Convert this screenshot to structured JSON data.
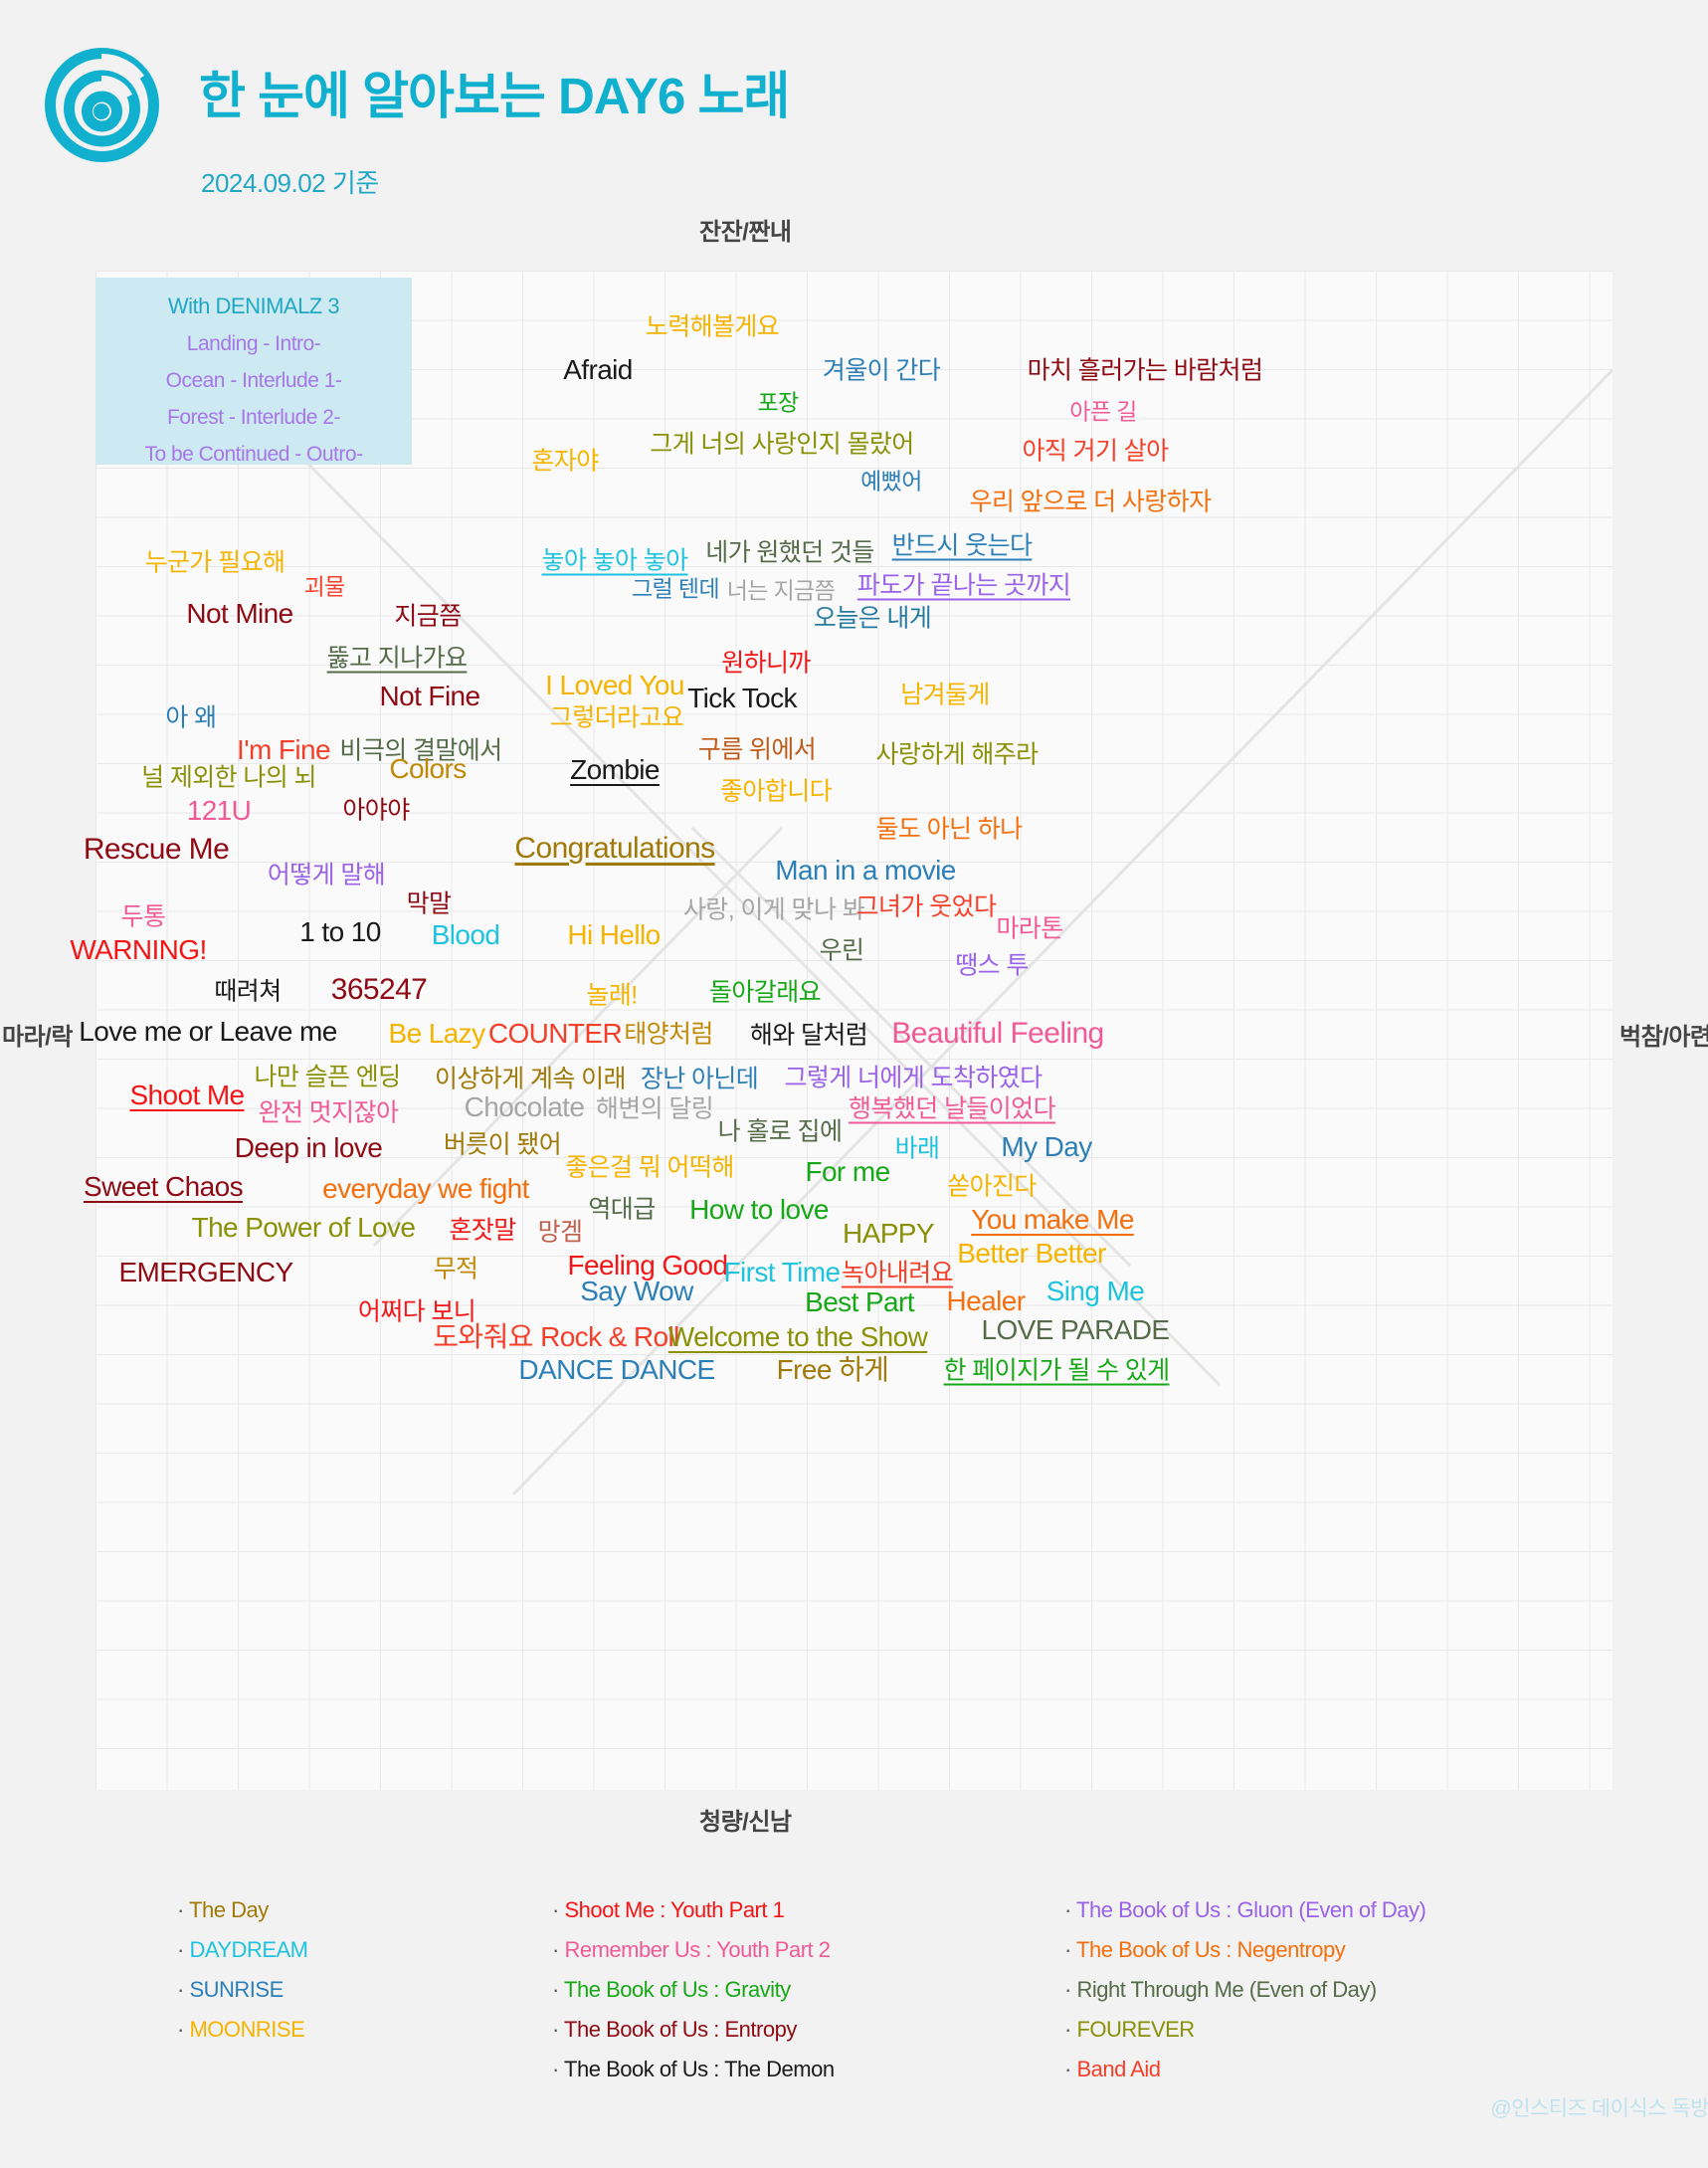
{
  "header": {
    "title": "한 눈에 알아보는 DAY6 노래",
    "subtitle": "2024.09.02 기준",
    "logo_icon": "day6-spiral-logo",
    "brand_color": "#12b0cf"
  },
  "axes": {
    "top": "잔잔/짠내",
    "bottom": "청량/신남",
    "left": "마라/락",
    "right": "벅참/아련"
  },
  "denimalz": {
    "title": "With DENIMALZ 3",
    "lines": [
      "Landing - Intro-",
      "Ocean - Interlude 1-",
      "Forest - Interlude 2-",
      "To be Continued - Outro-"
    ]
  },
  "credit": "@인스티즈 데이식스 독방",
  "legend": {
    "columns": [
      [
        {
          "label": "The Day",
          "color": "#a07a08"
        },
        {
          "label": "DAYDREAM",
          "color": "#1fc3dd"
        },
        {
          "label": "SUNRISE",
          "color": "#2d7fb8"
        },
        {
          "label": "MOONRISE",
          "color": "#f5b400"
        }
      ],
      [
        {
          "label": "Shoot Me : Youth Part 1",
          "color": "#f41616"
        },
        {
          "label": "Remember Us : Youth Part 2",
          "color": "#f05a96"
        },
        {
          "label": "The Book of Us : Gravity",
          "color": "#17a817"
        },
        {
          "label": "The Book of Us : Entropy",
          "color": "#8e0b15"
        },
        {
          "label": "The Book of Us : The Demon",
          "color": "#1a1a1a"
        }
      ],
      [
        {
          "label": "The Book of Us : Gluon (Even of Day)",
          "color": "#9a62e8"
        },
        {
          "label": "The Book of Us : Negentropy",
          "color": "#f4700f"
        },
        {
          "label": "Right Through Me (Even of Day)",
          "color": "#566b4a"
        },
        {
          "label": "FOUREVER",
          "color": "#8a9107"
        },
        {
          "label": "Band Aid",
          "color": "#f4402a"
        }
      ]
    ]
  },
  "chart_data": {
    "type": "scatter",
    "title": "한 눈에 알아보는 DAY6 노래",
    "subtitle": "2024.09.02 기준",
    "xlabel": "마라/락 ↔ 벅참/아련",
    "ylabel": "잔잔/짠내 ↔ 청량/신남",
    "xlim": [
      0,
      1525
    ],
    "ylim": [
      0,
      1527
    ],
    "grid": true,
    "legend_position": "bottom",
    "points": [
      {
        "t": "노력해볼게요",
        "x": 620,
        "y": 57,
        "c": "#f5b400",
        "s": 25
      },
      {
        "t": "Afraid",
        "x": 505,
        "y": 100,
        "c": "#1a1a1a",
        "s": 28
      },
      {
        "t": "겨울이 간다",
        "x": 790,
        "y": 101,
        "c": "#2d7fb8",
        "s": 25
      },
      {
        "t": "마치 흘러가는 바람처럼",
        "x": 1055,
        "y": 101,
        "c": "#8e0b15",
        "s": 25
      },
      {
        "t": "포장",
        "x": 686,
        "y": 133,
        "c": "#17a817",
        "s": 23
      },
      {
        "t": "아픈 길",
        "x": 1013,
        "y": 142,
        "c": "#f05a96",
        "s": 23
      },
      {
        "t": "그게 너의 사랑인지 몰랐어",
        "x": 690,
        "y": 175,
        "c": "#8a9107",
        "s": 25
      },
      {
        "t": "아직 거기 살아",
        "x": 1005,
        "y": 182,
        "c": "#f4402a",
        "s": 25
      },
      {
        "t": "혼자야",
        "x": 472,
        "y": 192,
        "c": "#f5b400",
        "s": 25
      },
      {
        "t": "예뻤어",
        "x": 800,
        "y": 212,
        "c": "#2d7fb8",
        "s": 23
      },
      {
        "t": "우리 앞으로 더 사랑하자",
        "x": 1000,
        "y": 233,
        "c": "#f4700f",
        "s": 25
      },
      {
        "t": "반드시 웃는다",
        "x": 871,
        "y": 277,
        "c": "#2d7fb8",
        "s": 25,
        "u": true
      },
      {
        "t": "누군가 필요해",
        "x": 120,
        "y": 294,
        "c": "#f5b400",
        "s": 25
      },
      {
        "t": "놓아 놓아 놓아",
        "x": 522,
        "y": 292,
        "c": "#1fc3dd",
        "s": 25,
        "u": true
      },
      {
        "t": "네가 원했던 것들",
        "x": 698,
        "y": 284,
        "c": "#566b4a",
        "s": 25
      },
      {
        "t": "파도가 끝나는 곳까지",
        "x": 873,
        "y": 317,
        "c": "#9a62e8",
        "s": 25,
        "u": true
      },
      {
        "t": "괴물",
        "x": 230,
        "y": 318,
        "c": "#f4402a",
        "s": 23
      },
      {
        "t": "그럴 텐데",
        "x": 583,
        "y": 320,
        "c": "#2d7fb8",
        "s": 23
      },
      {
        "t": "너는 지금쯤",
        "x": 689,
        "y": 322,
        "c": "#a6a6a6",
        "s": 23
      },
      {
        "t": "Not Mine",
        "x": 145,
        "y": 345,
        "c": "#8e0b15",
        "s": 28
      },
      {
        "t": "지금쯤",
        "x": 334,
        "y": 348,
        "c": "#8e0b15",
        "s": 25
      },
      {
        "t": "오늘은 내게",
        "x": 781,
        "y": 350,
        "c": "#247b9e",
        "s": 25
      },
      {
        "t": "뚫고 지나가요",
        "x": 303,
        "y": 390,
        "c": "#566b4a",
        "s": 25,
        "u": true
      },
      {
        "t": "원하니까",
        "x": 674,
        "y": 395,
        "c": "#f41616",
        "s": 25
      },
      {
        "t": "Not Fine",
        "x": 336,
        "y": 428,
        "c": "#8e0b15",
        "s": 28
      },
      {
        "t": "I Loved You",
        "x": 522,
        "y": 417,
        "c": "#f5b400",
        "s": 28
      },
      {
        "t": "Tick Tock",
        "x": 650,
        "y": 430,
        "c": "#1a1a1a",
        "s": 28
      },
      {
        "t": "남겨둘게",
        "x": 854,
        "y": 427,
        "c": "#f5b400",
        "s": 25
      },
      {
        "t": "아 왜",
        "x": 96,
        "y": 450,
        "c": "#2d7fb8",
        "s": 25
      },
      {
        "t": "그렇더라고요",
        "x": 524,
        "y": 450,
        "c": "#f5b400",
        "s": 25
      },
      {
        "t": "I'm Fine",
        "x": 189,
        "y": 482,
        "c": "#f4402a",
        "s": 28
      },
      {
        "t": "비극의 결말에서",
        "x": 327,
        "y": 483,
        "c": "#566b4a",
        "s": 25
      },
      {
        "t": "구름 위에서",
        "x": 665,
        "y": 482,
        "c": "#c05b1a",
        "s": 25
      },
      {
        "t": "사랑하게 해주라",
        "x": 866,
        "y": 487,
        "c": "#8a9107",
        "s": 25
      },
      {
        "t": "널 제외한 나의 뇌",
        "x": 134,
        "y": 510,
        "c": "#8a9107",
        "s": 25
      },
      {
        "t": "Colors",
        "x": 334,
        "y": 501,
        "c": "#c08a08",
        "s": 28
      },
      {
        "t": "Zombie",
        "x": 522,
        "y": 502,
        "c": "#1a1a1a",
        "s": 28,
        "u": true
      },
      {
        "t": "좋아합니다",
        "x": 684,
        "y": 524,
        "c": "#f5b400",
        "s": 25
      },
      {
        "t": "121U",
        "x": 124,
        "y": 543,
        "c": "#f05a96",
        "s": 28
      },
      {
        "t": "아야야",
        "x": 282,
        "y": 543,
        "c": "#8e0b15",
        "s": 25
      },
      {
        "t": "둘도 아닌 하나",
        "x": 858,
        "y": 562,
        "c": "#f4700f",
        "s": 25
      },
      {
        "t": "Rescue Me",
        "x": 61,
        "y": 582,
        "c": "#8e0b15",
        "s": 30
      },
      {
        "t": "Congratulations",
        "x": 522,
        "y": 581,
        "c": "#a07a08",
        "s": 30,
        "u": true
      },
      {
        "t": "Man in a movie",
        "x": 774,
        "y": 603,
        "c": "#2d7fb8",
        "s": 28
      },
      {
        "t": "어떻게 말해",
        "x": 232,
        "y": 608,
        "c": "#9a62e8",
        "s": 25
      },
      {
        "t": "막말",
        "x": 335,
        "y": 637,
        "c": "#8e0b15",
        "s": 25
      },
      {
        "t": "두통",
        "x": 48,
        "y": 650,
        "c": "#f05a96",
        "s": 25
      },
      {
        "t": "사랑, 이게 맞나 봐",
        "x": 682,
        "y": 643,
        "c": "#a6a6a6",
        "s": 25
      },
      {
        "t": "그녀가 웃었다",
        "x": 835,
        "y": 640,
        "c": "#f4402a",
        "s": 25
      },
      {
        "t": "WARNING!",
        "x": 43,
        "y": 683,
        "c": "#f41616",
        "s": 28
      },
      {
        "t": "1 to 10",
        "x": 246,
        "y": 665,
        "c": "#1a1a1a",
        "s": 28
      },
      {
        "t": "Blood",
        "x": 372,
        "y": 668,
        "c": "#1fc3dd",
        "s": 28
      },
      {
        "t": "Hi Hello",
        "x": 521,
        "y": 668,
        "c": "#f5b400",
        "s": 28
      },
      {
        "t": "마라톤",
        "x": 939,
        "y": 662,
        "c": "#f05a96",
        "s": 25
      },
      {
        "t": "우린",
        "x": 750,
        "y": 684,
        "c": "#566b4a",
        "s": 25
      },
      {
        "t": "땡스 투",
        "x": 901,
        "y": 699,
        "c": "#9a62e8",
        "s": 25
      },
      {
        "t": "때려쳐",
        "x": 153,
        "y": 725,
        "c": "#1a1a1a",
        "s": 25
      },
      {
        "t": "365247",
        "x": 285,
        "y": 723,
        "c": "#8e0b15",
        "s": 30
      },
      {
        "t": "놀래!",
        "x": 519,
        "y": 729,
        "c": "#f5b400",
        "s": 25
      },
      {
        "t": "돌아갈래요",
        "x": 673,
        "y": 726,
        "c": "#17a817",
        "s": 25
      },
      {
        "t": "Love me or Leave me",
        "x": 113,
        "y": 765,
        "c": "#1a1a1a",
        "s": 28
      },
      {
        "t": "Be Lazy",
        "x": 343,
        "y": 767,
        "c": "#f5b400",
        "s": 28
      },
      {
        "t": "COUNTER",
        "x": 462,
        "y": 767,
        "c": "#f4402a",
        "s": 28
      },
      {
        "t": "태양처럼",
        "x": 576,
        "y": 768,
        "c": "#c08a08",
        "s": 25
      },
      {
        "t": "해와 달처럼",
        "x": 717,
        "y": 769,
        "c": "#1a1a1a",
        "s": 25
      },
      {
        "t": "Beautiful Feeling",
        "x": 907,
        "y": 767,
        "c": "#f05a96",
        "s": 30
      },
      {
        "t": "나만 슬픈 엔딩",
        "x": 233,
        "y": 811,
        "c": "#8a9107",
        "s": 25
      },
      {
        "t": "이상하게 계속 이래",
        "x": 437,
        "y": 813,
        "c": "#a07a08",
        "s": 25
      },
      {
        "t": "장난 아닌데",
        "x": 607,
        "y": 813,
        "c": "#2d7fb8",
        "s": 25
      },
      {
        "t": "그렇게 너에게 도착하였다",
        "x": 822,
        "y": 812,
        "c": "#9a62e8",
        "s": 25
      },
      {
        "t": "Shoot Me",
        "x": 92,
        "y": 829,
        "c": "#f41616",
        "s": 28,
        "u": true
      },
      {
        "t": "완전 멋지잖아",
        "x": 234,
        "y": 847,
        "c": "#f05a96",
        "s": 25
      },
      {
        "t": "Chocolate",
        "x": 431,
        "y": 841,
        "c": "#a6a6a6",
        "s": 28
      },
      {
        "t": "해변의 달링",
        "x": 562,
        "y": 843,
        "c": "#a6a6a6",
        "s": 25
      },
      {
        "t": "행복했던 날들이었다",
        "x": 861,
        "y": 843,
        "c": "#f05a96",
        "s": 25,
        "u": true
      },
      {
        "t": "나 홀로 집에",
        "x": 688,
        "y": 866,
        "c": "#566b4a",
        "s": 25
      },
      {
        "t": "Deep in love",
        "x": 214,
        "y": 882,
        "c": "#8e0b15",
        "s": 28
      },
      {
        "t": "버릇이 됐어",
        "x": 409,
        "y": 879,
        "c": "#a07a08",
        "s": 25
      },
      {
        "t": "바래",
        "x": 826,
        "y": 883,
        "c": "#1fc3dd",
        "s": 25
      },
      {
        "t": "My Day",
        "x": 956,
        "y": 881,
        "c": "#2d7fb8",
        "s": 28
      },
      {
        "t": "좋은걸 뭐 어떡해",
        "x": 557,
        "y": 902,
        "c": "#f5b400",
        "s": 25
      },
      {
        "t": "For me",
        "x": 756,
        "y": 906,
        "c": "#17a817",
        "s": 28
      },
      {
        "t": "Sweet Chaos",
        "x": 68,
        "y": 921,
        "c": "#8e0b15",
        "s": 28,
        "u": true
      },
      {
        "t": "everyday we fight",
        "x": 332,
        "y": 923,
        "c": "#f4700f",
        "s": 28
      },
      {
        "t": "쏟아진다",
        "x": 901,
        "y": 921,
        "c": "#f5b400",
        "s": 25
      },
      {
        "t": "역대급",
        "x": 529,
        "y": 944,
        "c": "#566b4a",
        "s": 25
      },
      {
        "t": "How to love",
        "x": 667,
        "y": 944,
        "c": "#17a817",
        "s": 28
      },
      {
        "t": "You make Me",
        "x": 962,
        "y": 954,
        "c": "#f4700f",
        "s": 28,
        "u": true
      },
      {
        "t": "The Power of Love",
        "x": 209,
        "y": 962,
        "c": "#8a9107",
        "s": 28
      },
      {
        "t": "혼잣말",
        "x": 389,
        "y": 965,
        "c": "#f41616",
        "s": 25
      },
      {
        "t": "망겜",
        "x": 467,
        "y": 967,
        "c": "#c1604a",
        "s": 25
      },
      {
        "t": "HAPPY",
        "x": 797,
        "y": 968,
        "c": "#8a9107",
        "s": 28
      },
      {
        "t": "Better Better",
        "x": 941,
        "y": 988,
        "c": "#f5b400",
        "s": 28
      },
      {
        "t": "EMERGENCY",
        "x": 111,
        "y": 1007,
        "c": "#8e0b15",
        "s": 28
      },
      {
        "t": "무적",
        "x": 362,
        "y": 1004,
        "c": "#c08a08",
        "s": 25
      },
      {
        "t": "Feeling Good",
        "x": 555,
        "y": 1000,
        "c": "#f41616",
        "s": 28
      },
      {
        "t": "First Time",
        "x": 690,
        "y": 1007,
        "c": "#1fc3dd",
        "s": 28
      },
      {
        "t": "녹아내려요",
        "x": 806,
        "y": 1008,
        "c": "#f4402a",
        "s": 25,
        "u": true
      },
      {
        "t": "Healer",
        "x": 895,
        "y": 1036,
        "c": "#f4700f",
        "s": 28
      },
      {
        "t": "Sing Me",
        "x": 1005,
        "y": 1026,
        "c": "#1fc3dd",
        "s": 28
      },
      {
        "t": "Best Part",
        "x": 768,
        "y": 1037,
        "c": "#17a817",
        "s": 28
      },
      {
        "t": "Say Wow",
        "x": 544,
        "y": 1026,
        "c": "#2d7fb8",
        "s": 28
      },
      {
        "t": "어쩌다 보니",
        "x": 323,
        "y": 1047,
        "c": "#f41616",
        "s": 25
      },
      {
        "t": "도와줘요 Rock & Roll",
        "x": 463,
        "y": 1072,
        "c": "#f4402a",
        "s": 28
      },
      {
        "t": "Welcome to the Show",
        "x": 706,
        "y": 1072,
        "c": "#8a9107",
        "s": 28,
        "u": true
      },
      {
        "t": "LOVE PARADE",
        "x": 985,
        "y": 1065,
        "c": "#566b4a",
        "s": 28
      },
      {
        "t": "DANCE DANCE",
        "x": 524,
        "y": 1105,
        "c": "#2d7fb8",
        "s": 28
      },
      {
        "t": "Free 하게",
        "x": 741,
        "y": 1105,
        "c": "#a07a08",
        "s": 28
      },
      {
        "t": "한 페이지가 될 수 있게",
        "x": 966,
        "y": 1106,
        "c": "#17a817",
        "s": 25,
        "u": true
      }
    ]
  }
}
